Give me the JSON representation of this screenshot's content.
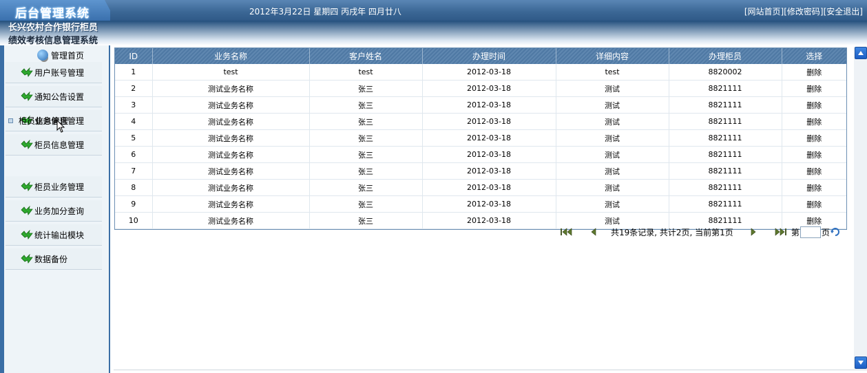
{
  "header": {
    "logo_text": "后台管理系统",
    "date": "2012年3月22日  星期四  丙戌年  四月廿八",
    "links": [
      "[网站首页]",
      "[修改密码]",
      "[安全退出]"
    ]
  },
  "system_title": [
    "长兴农村合作银行柜员",
    "绩效考核信息管理系统"
  ],
  "sidebar": {
    "home_label": "管理首页",
    "items": [
      "用户账号管理",
      "通知公告设置",
      "业务信息管理",
      "柜员信息管理",
      "柜员业务管理",
      "业务加分查询",
      "统计输出模块",
      "数据备份"
    ],
    "sub_item": "柜员信息管理"
  },
  "table": {
    "headers": [
      "ID",
      "业务名称",
      "客户姓名",
      "办理时间",
      "详细内容",
      "办理柜员",
      "选择"
    ],
    "rows": [
      [
        "1",
        "test",
        "test",
        "2012-03-18",
        "test",
        "8820002",
        "删除"
      ],
      [
        "2",
        "测试业务名称",
        "张三",
        "2012-03-18",
        "测试",
        "8821111",
        "删除"
      ],
      [
        "3",
        "测试业务名称",
        "张三",
        "2012-03-18",
        "测试",
        "8821111",
        "删除"
      ],
      [
        "4",
        "测试业务名称",
        "张三",
        "2012-03-18",
        "测试",
        "8821111",
        "删除"
      ],
      [
        "5",
        "测试业务名称",
        "张三",
        "2012-03-18",
        "测试",
        "8821111",
        "删除"
      ],
      [
        "6",
        "测试业务名称",
        "张三",
        "2012-03-18",
        "测试",
        "8821111",
        "删除"
      ],
      [
        "7",
        "测试业务名称",
        "张三",
        "2012-03-18",
        "测试",
        "8821111",
        "删除"
      ],
      [
        "8",
        "测试业务名称",
        "张三",
        "2012-03-18",
        "测试",
        "8821111",
        "删除"
      ],
      [
        "9",
        "测试业务名称",
        "张三",
        "2012-03-18",
        "测试",
        "8821111",
        "删除"
      ],
      [
        "10",
        "测试业务名称",
        "张三",
        "2012-03-18",
        "测试",
        "8821111",
        "删除"
      ]
    ]
  },
  "pager": {
    "info": "共19条记录, 共计2页, 当前第1页",
    "page_prefix": "第",
    "page_suffix": "页",
    "page_value": ""
  },
  "icons": {
    "menu": "green-arrow-icon",
    "home": "globe-computer-icon",
    "first": "first-page-icon",
    "prev": "prev-page-icon",
    "next": "next-page-icon",
    "last": "last-page-icon",
    "go": "go-refresh-icon"
  },
  "colors": {
    "topbar": "#3c6896",
    "sidebar_border": "#3a6ea5",
    "header_row": "#5f87b0",
    "menu_arrow": "#2ea82e"
  }
}
